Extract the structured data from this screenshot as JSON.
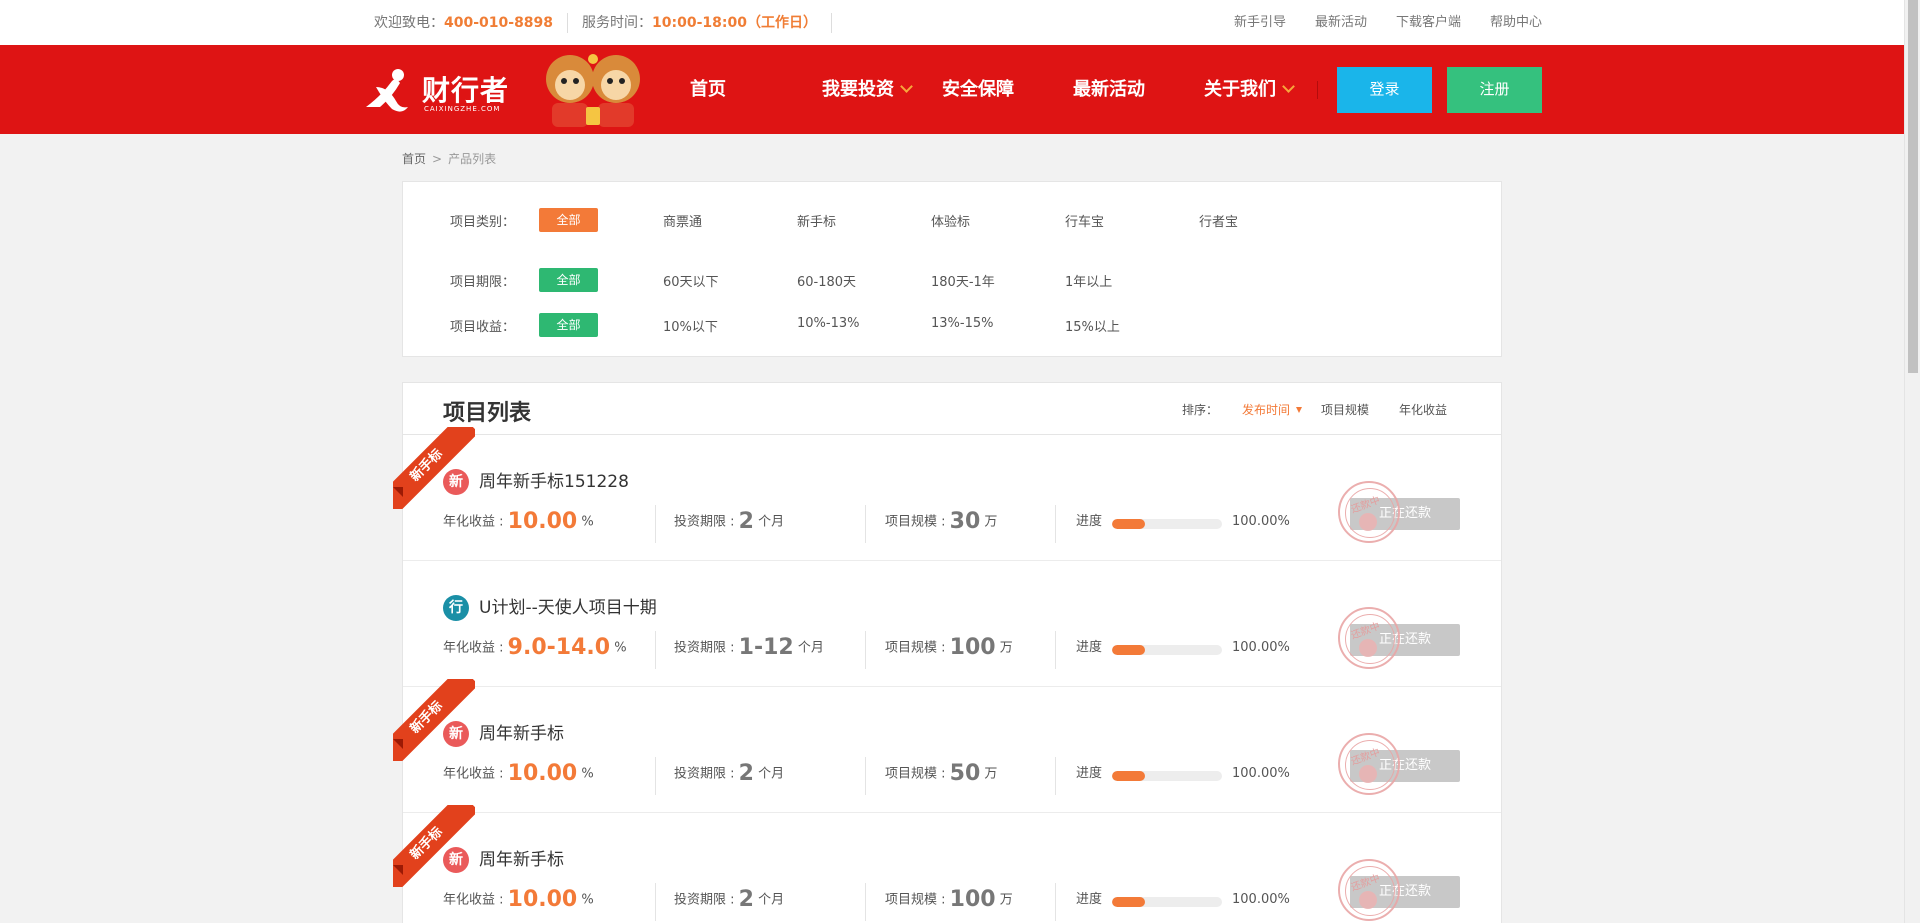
{
  "topbar": {
    "hotline_label": "欢迎致电：",
    "hotline": "400-010-8898",
    "hours_label": "服务时间：",
    "hours": "10:00-18:00（工作日）",
    "links": [
      "新手引导",
      "最新活动",
      "下载客户端",
      "帮助中心"
    ]
  },
  "header": {
    "brand": "财行者",
    "brand_sub": "CAIXINGZHE.COM",
    "nav": [
      {
        "label": "首页",
        "dropdown": false
      },
      {
        "label": "我要投资",
        "dropdown": true
      },
      {
        "label": "安全保障",
        "dropdown": false
      },
      {
        "label": "最新活动",
        "dropdown": false
      },
      {
        "label": "关于我们",
        "dropdown": true
      }
    ],
    "login": "登录",
    "register": "注册"
  },
  "breadcrumb": {
    "home": "首页",
    "sep": ">",
    "current": "产品列表"
  },
  "filters": {
    "category": {
      "label": "项目类别：",
      "all": "全部",
      "options": [
        "商票通",
        "新手标",
        "体验标",
        "行车宝",
        "行者宝"
      ]
    },
    "term": {
      "label": "项目期限：",
      "all": "全部",
      "options": [
        "60天以下",
        "60-180天",
        "180天-1年",
        "1年以上"
      ]
    },
    "yield": {
      "label": "项目收益：",
      "all": "全部",
      "options": [
        "10%以下",
        "10%-13%",
        "13%-15%",
        "15%以上"
      ]
    }
  },
  "list": {
    "title": "项目列表",
    "sort_label": "排序：",
    "sort_options": [
      "发布时间",
      "项目规模",
      "年化收益"
    ],
    "labels": {
      "yield": "年化收益 :",
      "term": "投资期限 :",
      "scale": "项目规模 :",
      "progress": "进度",
      "month": "个月",
      "wan": "万",
      "percent": "%"
    },
    "items": [
      {
        "ribbon": "新手标",
        "badge": "新",
        "title": "周年新手标151228",
        "yield": "10.00",
        "term": "2",
        "scale": "30",
        "progress_pct": "100.00%",
        "progress_fill": 0.3,
        "action": "正在还款",
        "stamp": "还款中"
      },
      {
        "ribbon": "",
        "badge": "行",
        "title": "U计划--天使人项目十期",
        "yield": "9.0-14.0",
        "term": "1-12",
        "scale": "100",
        "progress_pct": "100.00%",
        "progress_fill": 0.3,
        "action": "正在还款",
        "stamp": "还款中"
      },
      {
        "ribbon": "新手标",
        "badge": "新",
        "title": "周年新手标",
        "yield": "10.00",
        "term": "2",
        "scale": "50",
        "progress_pct": "100.00%",
        "progress_fill": 0.3,
        "action": "正在还款",
        "stamp": "还款中"
      },
      {
        "ribbon": "新手标",
        "badge": "新",
        "title": "周年新手标",
        "yield": "10.00",
        "term": "2",
        "scale": "100",
        "progress_pct": "100.00%",
        "progress_fill": 0.3,
        "action": "正在还款",
        "stamp": "还款中"
      }
    ]
  },
  "colors": {
    "brand_red": "#de1414",
    "accent_orange": "#f37a38",
    "login_blue": "#1ab5ea",
    "register_green": "#35c17e"
  }
}
